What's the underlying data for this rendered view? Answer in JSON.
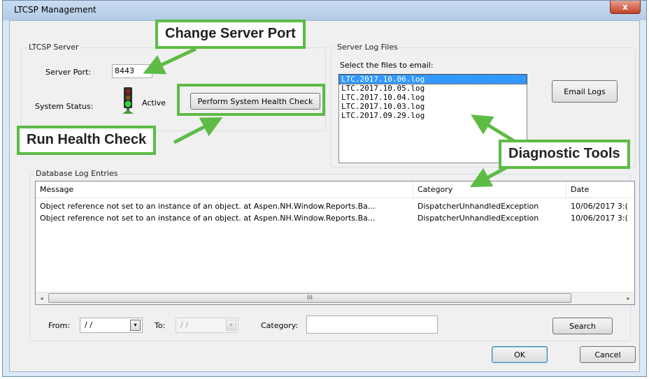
{
  "window": {
    "title": "LTCSP Management",
    "close_glyph": "x"
  },
  "server_group": {
    "label": "LTCSP Server",
    "port_label": "Server Port:",
    "port_value": "8443",
    "status_label": "System Status:",
    "status_value": "Active",
    "status_icon": "traffic-light-green",
    "health_button": "Perform System Health Check"
  },
  "log_files_group": {
    "label": "Server Log Files",
    "prompt": "Select the files to email:",
    "files": [
      "LTC.2017.10.06.log",
      "LTC.2017.10.05.log",
      "LTC.2017.10.04.log",
      "LTC.2017.10.03.log",
      "LTC.2017.09.29.log"
    ],
    "selected_index": 0,
    "email_button": "Email Logs"
  },
  "db_log_group": {
    "label": "Database Log Entries",
    "columns": [
      "Message",
      "Category",
      "Date"
    ],
    "rows": [
      {
        "message": "Object reference not set to an instance of an object.   at Aspen.NH.Window.Reports.Ba...",
        "category": "DispatcherUnhandledException",
        "date": "10/06/2017 3:("
      },
      {
        "message": "Object reference not set to an instance of an object.   at Aspen.NH.Window.Reports.Ba...",
        "category": "DispatcherUnhandledException",
        "date": "10/06/2017 3:("
      }
    ],
    "scroll_left_glyph": "◂",
    "scroll_right_glyph": "▸",
    "thumb_grip": "III"
  },
  "filter": {
    "from_label": "From:",
    "from_value": "/ /",
    "to_label": "To:",
    "to_value": "/ /",
    "dropdown_glyph": "▾",
    "category_label": "Category:",
    "category_value": "",
    "search_button": "Search"
  },
  "dialog_buttons": {
    "ok": "OK",
    "cancel": "Cancel"
  },
  "annotations": {
    "change_port": "Change Server Port",
    "health_check": "Run Health Check",
    "diagnostic_tools": "Diagnostic Tools"
  },
  "colors": {
    "accent_green": "#5dbb46",
    "selection_blue": "#3399ff",
    "window_frame": "#dbe8f5",
    "close_red": "#c4412a"
  }
}
